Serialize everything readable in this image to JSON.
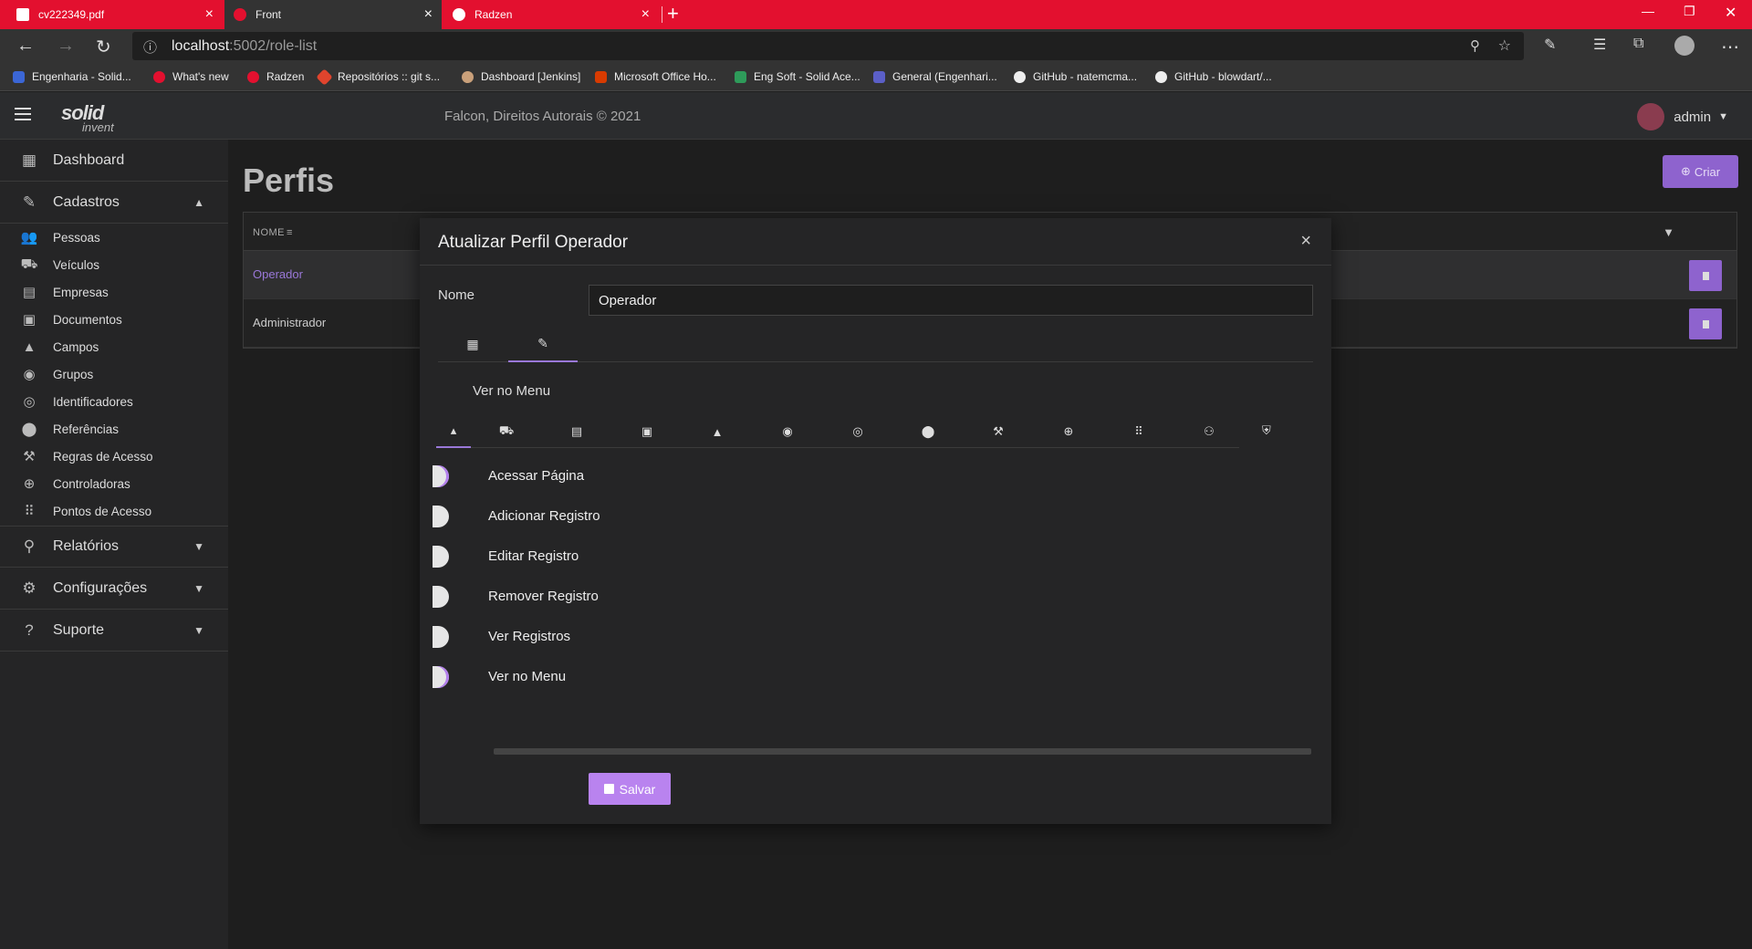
{
  "browser": {
    "tabs": [
      {
        "title": "cv222349.pdf",
        "icon": "pdf-icon",
        "active": false
      },
      {
        "title": "Front",
        "icon": "radzen-icon",
        "active": true
      },
      {
        "title": "Radzen",
        "icon": "radzen-icon",
        "active": false
      }
    ],
    "url_host": "localhost",
    "url_rest": ":5002/role-list",
    "bookmarks": [
      "Engenharia - Solid...",
      "What's new",
      "Radzen",
      "Repositórios :: git s...",
      "Dashboard [Jenkins]",
      "Microsoft Office Ho...",
      "Eng Soft - Solid Ace...",
      "General (Engenhari...",
      "GitHub - natemcma...",
      "GitHub - blowdart/..."
    ]
  },
  "header": {
    "logo_main": "solid",
    "logo_sub": "invent",
    "copyright": "Falcon, Direitos Autorais © 2021",
    "user": "admin"
  },
  "sidebar": {
    "dashboard": "Dashboard",
    "cadastros": "Cadastros",
    "sub_items": [
      "Pessoas",
      "Veículos",
      "Empresas",
      "Documentos",
      "Campos",
      "Grupos",
      "Identificadores",
      "Referências",
      "Regras de Acesso",
      "Controladoras",
      "Pontos de Acesso"
    ],
    "relatorios": "Relatórios",
    "configuracoes": "Configurações",
    "suporte": "Suporte"
  },
  "page": {
    "title": "Perfis",
    "criar_label": "Criar",
    "grid_header": "NOME",
    "rows": [
      "Operador",
      "Administrador"
    ]
  },
  "modal": {
    "title": "Atualizar Perfil Operador",
    "nome_label": "Nome",
    "nome_value": "Operador",
    "section_title": "Ver no Menu",
    "permissions": [
      "Acessar Página",
      "Adicionar Registro",
      "Editar Registro",
      "Remover Registro",
      "Ver Registros",
      "Ver no Menu"
    ],
    "permission_states": [
      true,
      false,
      false,
      false,
      false,
      true
    ],
    "salvar_label": "Salvar"
  },
  "colors": {
    "accent": "#9a78d8",
    "button": "#8e63ce",
    "browser_bar": "#e3102f"
  }
}
